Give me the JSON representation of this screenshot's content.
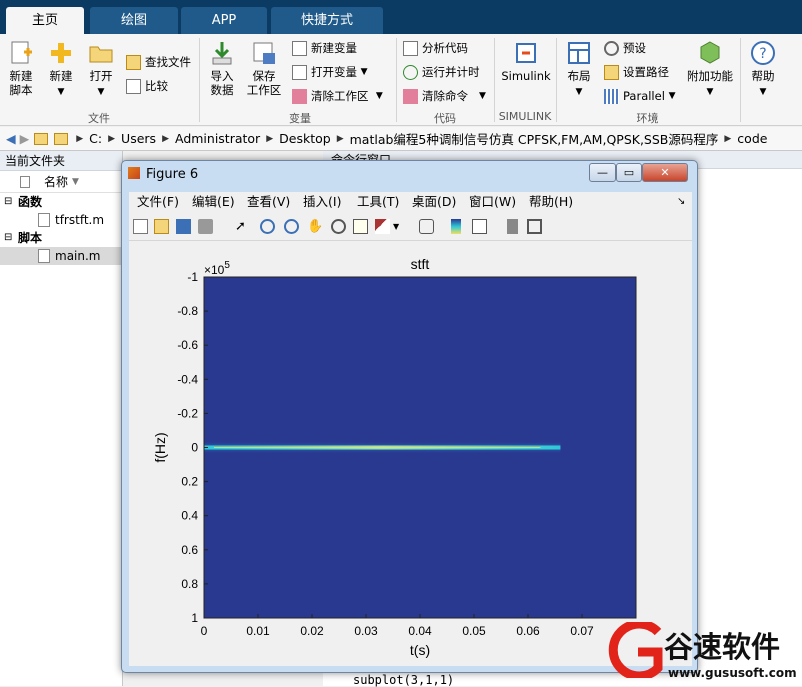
{
  "tabs": [
    {
      "label": "主页"
    },
    {
      "label": "绘图"
    },
    {
      "label": "APP"
    },
    {
      "label": "快捷方式"
    }
  ],
  "ribbon": {
    "new_script": "新建\n脚本",
    "new": "新建",
    "open": "打开",
    "find_files": "查找文件",
    "compare": "比较",
    "import": "导入\n数据",
    "save_ws": "保存\n工作区",
    "new_var": "新建变量",
    "open_var": "打开变量",
    "clear_ws": "清除工作区",
    "analyze": "分析代码",
    "run_time": "运行并计时",
    "clear_cmd": "清除命令",
    "simulink": "Simulink",
    "layout": "布局",
    "prefs": "预设",
    "set_path": "设置路径",
    "parallel": "Parallel",
    "addons": "附加功能",
    "help": "帮助",
    "groups": {
      "file": "文件",
      "var": "变量",
      "code": "代码",
      "simulink": "SIMULINK",
      "env": "环境"
    }
  },
  "address": [
    "C:",
    "Users",
    "Administrator",
    "Desktop",
    "matlab编程5种调制信号仿真 CPFSK,FM,AM,QPSK,SSB源码程序",
    "code"
  ],
  "left_panel": {
    "title": "当前文件夹",
    "col_name": "名称",
    "groups": [
      {
        "label": "函数",
        "files": [
          "tfrstft.m"
        ]
      },
      {
        "label": "脚本",
        "files": [
          "main.m"
        ]
      }
    ]
  },
  "cmd_window": {
    "title": "命令行窗口",
    "bottom_code": "subplot(3,1,1)"
  },
  "figure": {
    "title": "Figure 6",
    "menu": [
      "文件(F)",
      "编辑(E)",
      "查看(V)",
      "插入(I)",
      "工具(T)",
      "桌面(D)",
      "窗口(W)",
      "帮助(H)"
    ]
  },
  "chart_data": {
    "type": "heatmap",
    "title": "stft",
    "xlabel": "t(s)",
    "ylabel": "f(Hz)",
    "y_exponent": "×10^5",
    "x_ticks": [
      "0",
      "0.01",
      "0.02",
      "0.03",
      "0.04",
      "0.05",
      "0.06",
      "0.07"
    ],
    "y_ticks": [
      "-1",
      "-0.8",
      "-0.6",
      "-0.4",
      "-0.2",
      "0",
      "0.2",
      "0.4",
      "0.6",
      "0.8",
      "1"
    ],
    "xlim": [
      0,
      0.08
    ],
    "ylim": [
      -1,
      1
    ],
    "y_reversed": true,
    "band": {
      "f": 0,
      "t_start": 0,
      "t_end": 0.066,
      "description_colors": [
        "#2ec8d8",
        "#f0e060"
      ]
    },
    "background_color": "#2a3990"
  },
  "watermark": {
    "brand": "谷速软件",
    "url": "www.gususoft.com"
  }
}
